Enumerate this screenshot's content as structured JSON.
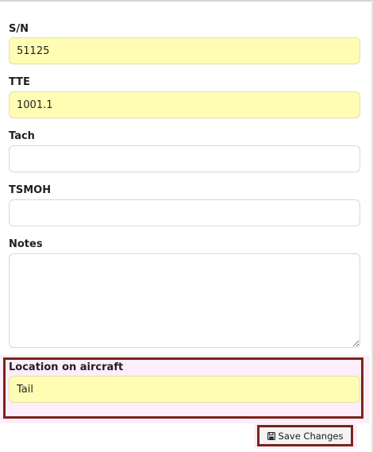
{
  "form": {
    "serial_number": {
      "label": "S/N",
      "value": "51125"
    },
    "tte": {
      "label": "TTE",
      "value": "1001.1"
    },
    "tach": {
      "label": "Tach",
      "value": ""
    },
    "tsmoh": {
      "label": "TSMOH",
      "value": ""
    },
    "notes": {
      "label": "Notes",
      "value": ""
    },
    "location": {
      "label": "Location on aircraft",
      "value": "Tail"
    }
  },
  "actions": {
    "save_label": "Save Changes",
    "save_icon": "floppy-disk-icon"
  },
  "colors": {
    "filled_field_bg": "#fffdb3",
    "highlight_border": "#7a2519",
    "highlight_bg": "#fdeefb"
  }
}
